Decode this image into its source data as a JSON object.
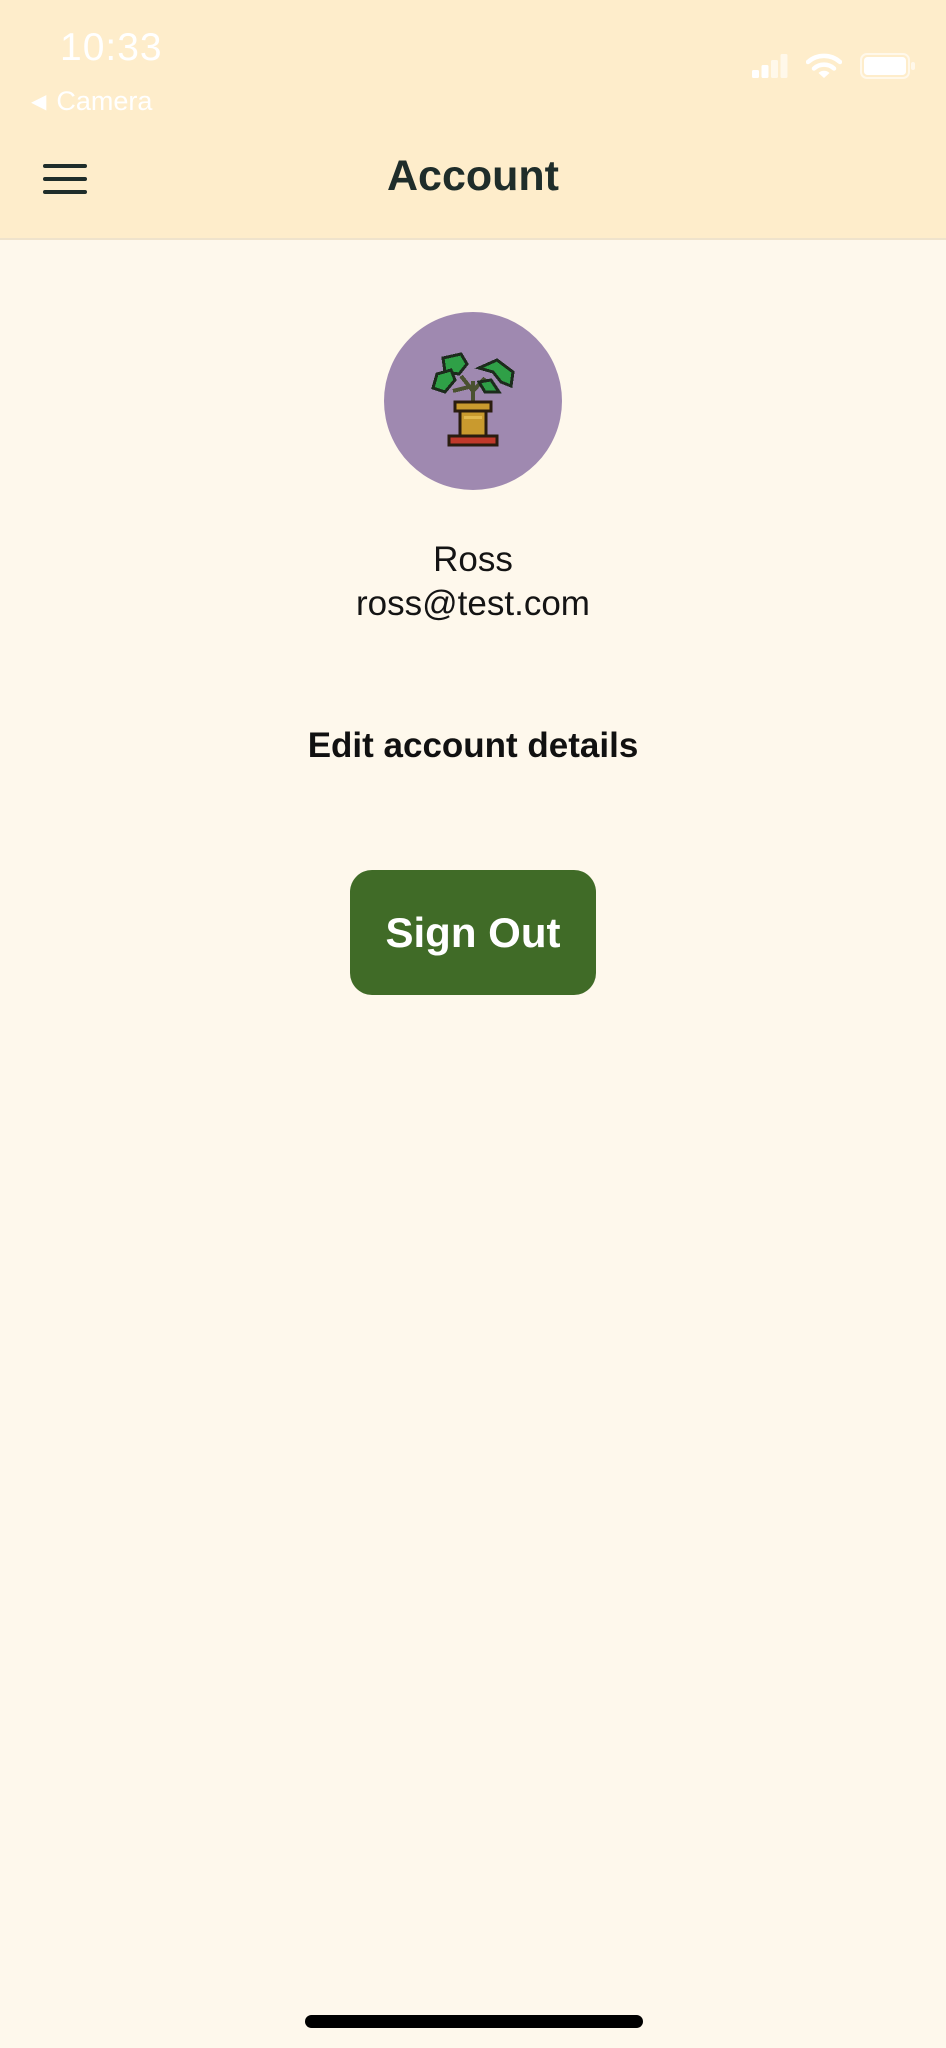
{
  "status_bar": {
    "time": "10:33",
    "back_label": "Camera",
    "icons": [
      "cellular-signal-icon",
      "wifi-icon",
      "battery-icon"
    ]
  },
  "header": {
    "title": "Account",
    "menu_icon": "hamburger-menu-icon"
  },
  "profile": {
    "avatar_icon": "potted-plant-icon",
    "name": "Ross",
    "email": "ross@test.com"
  },
  "actions": {
    "edit_label": "Edit account details",
    "sign_out_label": "Sign Out"
  },
  "colors": {
    "header_bg": "#FEEDCB",
    "page_bg": "#FEF8EC",
    "avatar_bg": "#9F89B0",
    "button_bg": "#406B27",
    "title_text": "#1F2D2A"
  }
}
